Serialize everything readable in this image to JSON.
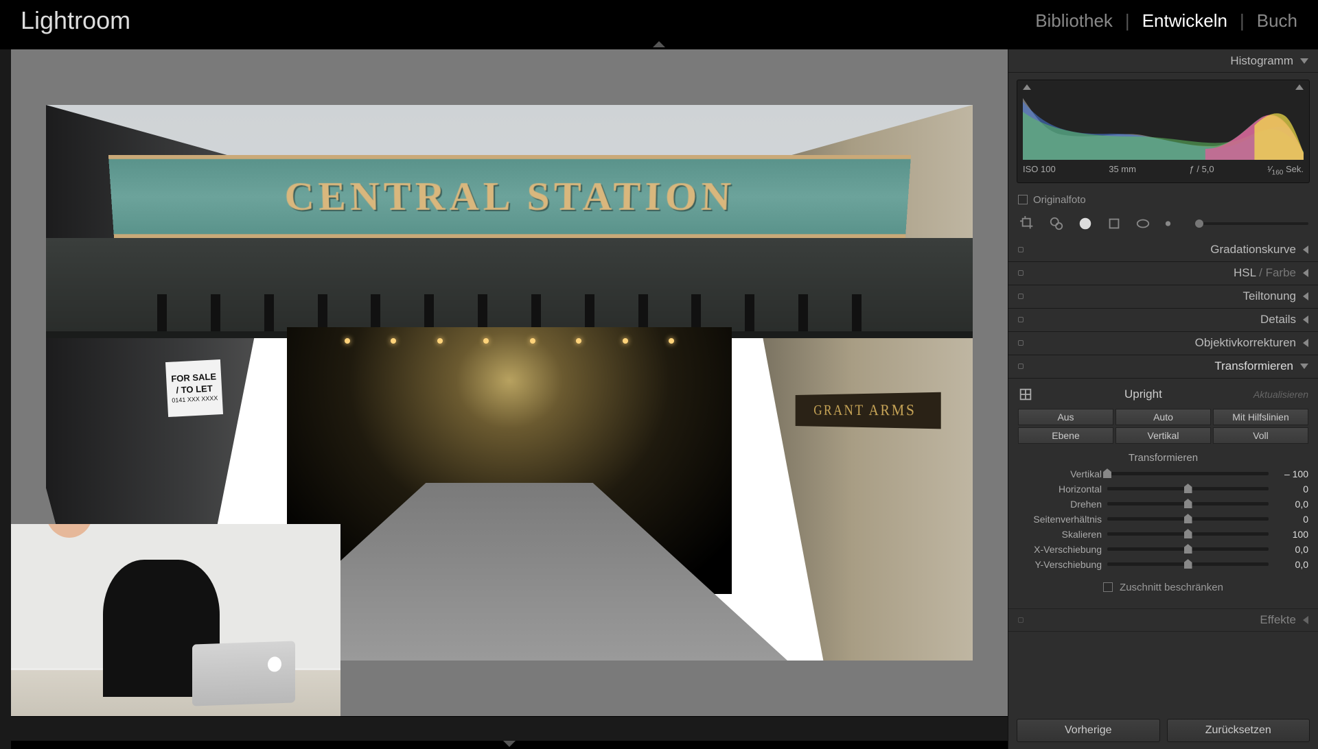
{
  "app_title": "Lightroom",
  "nav": {
    "library": "Bibliothek",
    "develop": "Entwickeln",
    "book": "Buch",
    "active": "Entwickeln"
  },
  "histogram": {
    "title": "Histogramm",
    "iso": "ISO 100",
    "focal": "35 mm",
    "aperture": "ƒ / 5,0",
    "shutter_pre": "¹⁄",
    "shutter_sub": "160",
    "shutter_post": " Sek.",
    "original_label": "Originalfoto"
  },
  "panels": {
    "tone_curve": "Gradationskurve",
    "hsl": "HSL",
    "color": "Farbe",
    "split_toning": "Teiltonung",
    "detail": "Details",
    "lens": "Objektivkorrekturen",
    "transform": "Transformieren",
    "effects": "Effekte"
  },
  "transform": {
    "upright_label": "Upright",
    "update_label": "Aktualisieren",
    "buttons": {
      "off": "Aus",
      "auto": "Auto",
      "guided": "Mit Hilfslinien",
      "level": "Ebene",
      "vertical": "Vertikal",
      "full": "Voll"
    },
    "section_title": "Transformieren",
    "sliders": [
      {
        "label": "Vertikal",
        "value": "– 100",
        "pos": 0
      },
      {
        "label": "Horizontal",
        "value": "0",
        "pos": 50
      },
      {
        "label": "Drehen",
        "value": "0,0",
        "pos": 50
      },
      {
        "label": "Seitenverhältnis",
        "value": "0",
        "pos": 50
      },
      {
        "label": "Skalieren",
        "value": "100",
        "pos": 50
      },
      {
        "label": "X-Verschiebung",
        "value": "0,0",
        "pos": 50
      },
      {
        "label": "Y-Verschiebung",
        "value": "0,0",
        "pos": 50
      }
    ],
    "constrain": "Zuschnitt beschränken"
  },
  "footer": {
    "previous": "Vorherige",
    "reset": "Zurücksetzen"
  },
  "photo": {
    "sign_text": "CENTRAL STATION",
    "pub_sign": "GRANT ARMS",
    "sale_1": "FOR SALE",
    "sale_2": "/ TO LET",
    "sale_3": "0141 XXX XXXX"
  }
}
